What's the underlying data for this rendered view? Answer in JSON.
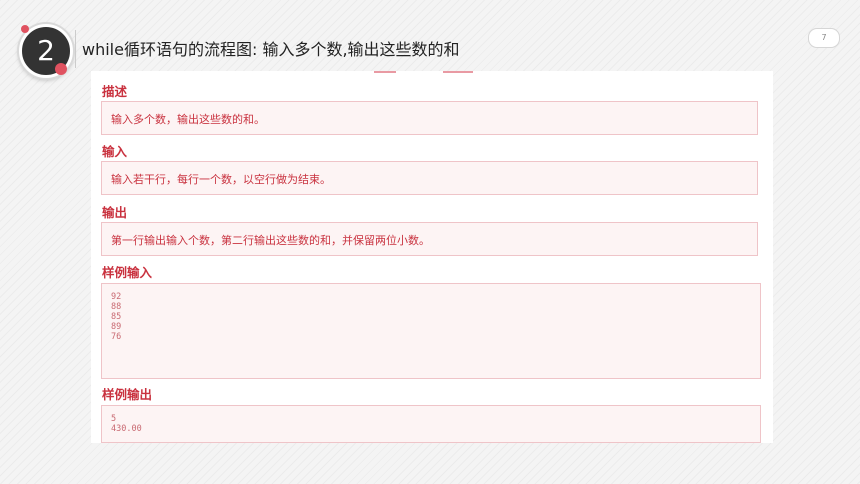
{
  "slide": {
    "number": "2",
    "title": "while循环语句的流程图: 输入多个数,输出这些数的和",
    "page_number": "7"
  },
  "problem": {
    "description": {
      "heading": "描述",
      "text": "输入多个数，输出这些数的和。"
    },
    "input": {
      "heading": "输入",
      "text": "输入若干行，每行一个数，以空行做为结束。"
    },
    "output": {
      "heading": "输出",
      "text": "第一行输出输入个数，第二行输出这些数的和，并保留两位小数。"
    },
    "sample_input": {
      "heading": "样例输入",
      "lines": [
        "92",
        "88",
        "85",
        "89",
        "76"
      ]
    },
    "sample_output": {
      "heading": "样例输出",
      "lines": [
        "5",
        "430.00"
      ]
    }
  },
  "colors": {
    "accent": "#c9323f",
    "box_background": "#fdf4f4",
    "box_border": "#efc4c8",
    "badge_dark": "#333333",
    "dot_red": "#e05260"
  }
}
